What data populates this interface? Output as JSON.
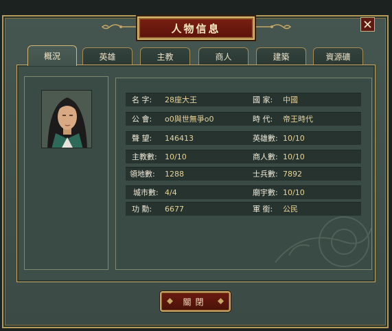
{
  "window": {
    "title": "人物信息"
  },
  "tabs": [
    {
      "label": "概況",
      "active": true
    },
    {
      "label": "英雄",
      "active": false
    },
    {
      "label": "主教",
      "active": false
    },
    {
      "label": "商人",
      "active": false
    },
    {
      "label": "建築",
      "active": false
    },
    {
      "label": "資源礦",
      "active": false
    }
  ],
  "info": {
    "rows": [
      {
        "left_label": "名 字:",
        "left_value": "28座大王",
        "right_label": "國 家:",
        "right_value": "中國"
      },
      {
        "left_label": "公 會:",
        "left_value": "o0與世無爭o0",
        "right_label": "時 代:",
        "right_value": "帝王時代"
      },
      {
        "left_label": "聲 望:",
        "left_value": "146413",
        "right_label": "英雄數:",
        "right_value": "10/10"
      },
      {
        "left_label": "主教數:",
        "left_value": "10/10",
        "right_label": "商人數:",
        "right_value": "10/10"
      },
      {
        "left_label": "領地數:",
        "left_value": "1288",
        "right_label": "士兵數:",
        "right_value": "7892"
      },
      {
        "left_label": "城市數:",
        "left_value": "4/4",
        "right_label": "廟宇數:",
        "right_value": "10/10"
      },
      {
        "left_label": "功 勳:",
        "left_value": "6677",
        "right_label": "軍 銜:",
        "right_value": "公民"
      }
    ]
  },
  "buttons": {
    "close_label": "關閉"
  },
  "icons": {
    "close": "close-x-icon",
    "portrait": "character-portrait"
  },
  "colors": {
    "title_plate": "#6b1a10",
    "border_gold": "#c5a965",
    "value_text": "#e8d49a",
    "panel": "#3e4f49"
  }
}
